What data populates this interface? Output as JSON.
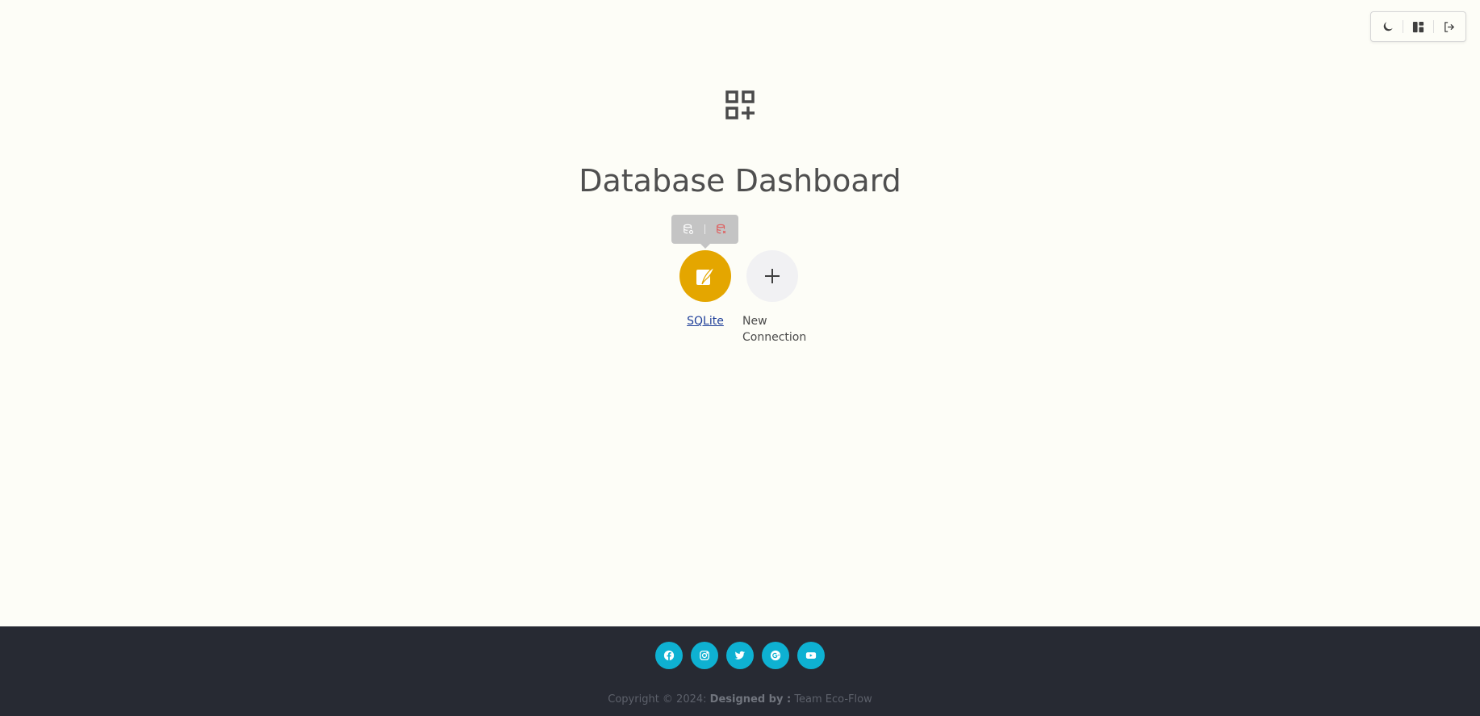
{
  "toolbar": {
    "items": [
      {
        "icon": "moon-icon",
        "name": "theme-toggle-button"
      },
      {
        "icon": "layout-icon",
        "name": "layout-button"
      },
      {
        "icon": "logout-icon",
        "name": "logout-button"
      }
    ]
  },
  "header": {
    "icon": "grid-plus-icon",
    "title": "Database Dashboard"
  },
  "tooltip": {
    "items": [
      {
        "icon": "database-settings-icon",
        "color": "#ffffff"
      },
      {
        "icon": "database-remove-icon",
        "color": "#e05a5a"
      }
    ]
  },
  "connections": [
    {
      "label": "SQLite",
      "icon": "feather-icon",
      "color": "#e4a600",
      "linked": true
    },
    {
      "label": "New Connection",
      "icon": "plus-icon",
      "color": "#f1f1f3",
      "linked": false
    }
  ],
  "footer": {
    "socials": [
      "facebook-icon",
      "instagram-icon",
      "twitter-icon",
      "google-plus-icon",
      "youtube-icon"
    ],
    "social_color": "#0eb1d2",
    "copyright_prefix": "Copyright © 2024:",
    "designed_by_label": "Designed by :",
    "team": "Team Eco-Flow"
  },
  "colors": {
    "background": "#fdfdf7",
    "footer": "#272a33",
    "title": "#4f4f4f"
  }
}
